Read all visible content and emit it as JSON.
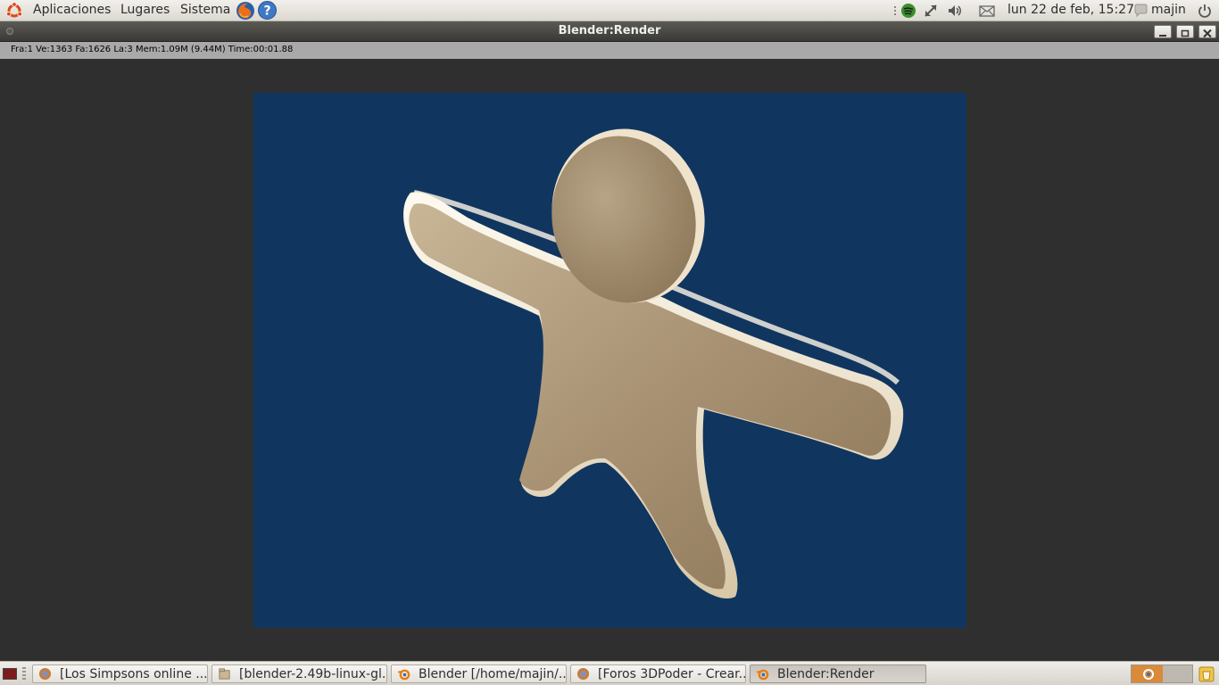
{
  "top_panel": {
    "menus": [
      "Aplicaciones",
      "Lugares",
      "Sistema"
    ],
    "launchers": [
      "firefox-icon",
      "help-icon"
    ],
    "tray_icons": [
      "spotify-icon",
      "network-icon",
      "volume-icon",
      "mail-icon"
    ],
    "clock": "lun 22 de feb, 15:27",
    "user": "majin",
    "power_icon": "power-icon"
  },
  "window": {
    "title": "Blender:Render",
    "controls": [
      "minimize-icon",
      "maximize-icon",
      "close-icon"
    ]
  },
  "render_info": "Fra:1  Ve:1363 Fa:1626 La:3 Mem:1.09M (9.44M) Time:00:01.88",
  "render": {
    "background_color": "#10365f",
    "subject_color": "#b4a184"
  },
  "taskbar": {
    "tasks": [
      {
        "label": "[Los Simpsons online ...",
        "icon": "firefox-icon"
      },
      {
        "label": "[blender-2.49b-linux-gl...",
        "icon": "folder-icon"
      },
      {
        "label": "Blender [/home/majin/...",
        "icon": "blender-icon"
      },
      {
        "label": "[Foros 3DPoder - Crear...",
        "icon": "firefox-icon"
      },
      {
        "label": "Blender:Render",
        "icon": "blender-icon",
        "active": true
      }
    ],
    "workspace_switcher_icon": "workspace-icon",
    "trash_icon": "trash-icon"
  }
}
